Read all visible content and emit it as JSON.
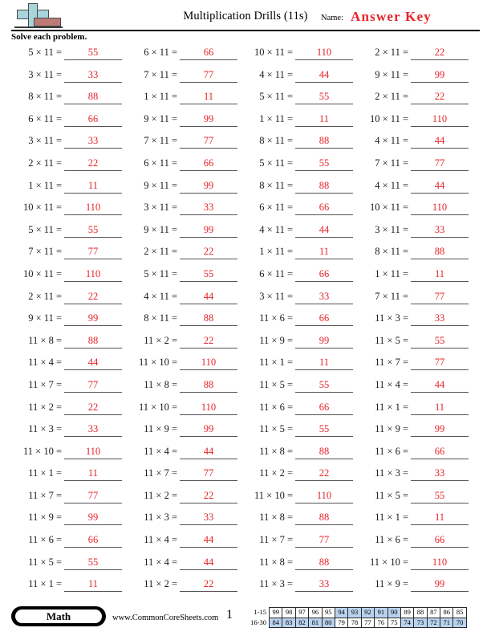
{
  "header": {
    "title": "Multiplication Drills (11s)",
    "name_label": "Name:",
    "answer_key": "Answer Key",
    "instructions": "Solve each problem.",
    "logo_name": "math-plus-logo",
    "answer_color": "#e8232a"
  },
  "footer": {
    "subject_badge": "Math",
    "site_url": "www.CommonCoreSheets.com",
    "page_number": "1",
    "score_rows": [
      {
        "label": "1-15",
        "cells": [
          {
            "value": "99",
            "highlighted": false
          },
          {
            "value": "98",
            "highlighted": false
          },
          {
            "value": "97",
            "highlighted": false
          },
          {
            "value": "96",
            "highlighted": false
          },
          {
            "value": "95",
            "highlighted": false
          },
          {
            "value": "94",
            "highlighted": true
          },
          {
            "value": "93",
            "highlighted": true
          },
          {
            "value": "92",
            "highlighted": true
          },
          {
            "value": "91",
            "highlighted": true
          },
          {
            "value": "90",
            "highlighted": true
          },
          {
            "value": "89",
            "highlighted": false
          },
          {
            "value": "88",
            "highlighted": false
          },
          {
            "value": "87",
            "highlighted": false
          },
          {
            "value": "86",
            "highlighted": false
          },
          {
            "value": "85",
            "highlighted": false
          }
        ]
      },
      {
        "label": "16-30",
        "cells": [
          {
            "value": "84",
            "highlighted": true
          },
          {
            "value": "83",
            "highlighted": true
          },
          {
            "value": "82",
            "highlighted": true
          },
          {
            "value": "81",
            "highlighted": true
          },
          {
            "value": "80",
            "highlighted": true
          },
          {
            "value": "79",
            "highlighted": false
          },
          {
            "value": "78",
            "highlighted": false
          },
          {
            "value": "77",
            "highlighted": false
          },
          {
            "value": "76",
            "highlighted": false
          },
          {
            "value": "75",
            "highlighted": false
          },
          {
            "value": "74",
            "highlighted": true
          },
          {
            "value": "73",
            "highlighted": true
          },
          {
            "value": "72",
            "highlighted": true
          },
          {
            "value": "71",
            "highlighted": true
          },
          {
            "value": "70",
            "highlighted": true
          }
        ]
      }
    ],
    "highlight_color": "#b9d2ee"
  },
  "columns": [
    {
      "problems": [
        {
          "question": "5 × 11 =",
          "answer": "55"
        },
        {
          "question": "3 × 11 =",
          "answer": "33"
        },
        {
          "question": "8 × 11 =",
          "answer": "88"
        },
        {
          "question": "6 × 11 =",
          "answer": "66"
        },
        {
          "question": "3 × 11 =",
          "answer": "33"
        },
        {
          "question": "2 × 11 =",
          "answer": "22"
        },
        {
          "question": "1 × 11 =",
          "answer": "11"
        },
        {
          "question": "10 × 11 =",
          "answer": "110"
        },
        {
          "question": "5 × 11 =",
          "answer": "55"
        },
        {
          "question": "7 × 11 =",
          "answer": "77"
        },
        {
          "question": "10 × 11 =",
          "answer": "110"
        },
        {
          "question": "2 × 11 =",
          "answer": "22"
        },
        {
          "question": "9 × 11 =",
          "answer": "99"
        },
        {
          "question": "11 × 8 =",
          "answer": "88"
        },
        {
          "question": "11 × 4 =",
          "answer": "44"
        },
        {
          "question": "11 × 7 =",
          "answer": "77"
        },
        {
          "question": "11 × 2 =",
          "answer": "22"
        },
        {
          "question": "11 × 3 =",
          "answer": "33"
        },
        {
          "question": "11 × 10 =",
          "answer": "110"
        },
        {
          "question": "11 × 1 =",
          "answer": "11"
        },
        {
          "question": "11 × 7 =",
          "answer": "77"
        },
        {
          "question": "11 × 9 =",
          "answer": "99"
        },
        {
          "question": "11 × 6 =",
          "answer": "66"
        },
        {
          "question": "11 × 5 =",
          "answer": "55"
        },
        {
          "question": "11 × 1 =",
          "answer": "11"
        }
      ]
    },
    {
      "problems": [
        {
          "question": "6 × 11 =",
          "answer": "66"
        },
        {
          "question": "7 × 11 =",
          "answer": "77"
        },
        {
          "question": "1 × 11 =",
          "answer": "11"
        },
        {
          "question": "9 × 11 =",
          "answer": "99"
        },
        {
          "question": "7 × 11 =",
          "answer": "77"
        },
        {
          "question": "6 × 11 =",
          "answer": "66"
        },
        {
          "question": "9 × 11 =",
          "answer": "99"
        },
        {
          "question": "3 × 11 =",
          "answer": "33"
        },
        {
          "question": "9 × 11 =",
          "answer": "99"
        },
        {
          "question": "2 × 11 =",
          "answer": "22"
        },
        {
          "question": "5 × 11 =",
          "answer": "55"
        },
        {
          "question": "4 × 11 =",
          "answer": "44"
        },
        {
          "question": "8 × 11 =",
          "answer": "88"
        },
        {
          "question": "11 × 2 =",
          "answer": "22"
        },
        {
          "question": "11 × 10 =",
          "answer": "110"
        },
        {
          "question": "11 × 8 =",
          "answer": "88"
        },
        {
          "question": "11 × 10 =",
          "answer": "110"
        },
        {
          "question": "11 × 9 =",
          "answer": "99"
        },
        {
          "question": "11 × 4 =",
          "answer": "44"
        },
        {
          "question": "11 × 7 =",
          "answer": "77"
        },
        {
          "question": "11 × 2 =",
          "answer": "22"
        },
        {
          "question": "11 × 3 =",
          "answer": "33"
        },
        {
          "question": "11 × 4 =",
          "answer": "44"
        },
        {
          "question": "11 × 4 =",
          "answer": "44"
        },
        {
          "question": "11 × 2 =",
          "answer": "22"
        }
      ]
    },
    {
      "problems": [
        {
          "question": "10 × 11 =",
          "answer": "110"
        },
        {
          "question": "4 × 11 =",
          "answer": "44"
        },
        {
          "question": "5 × 11 =",
          "answer": "55"
        },
        {
          "question": "1 × 11 =",
          "answer": "11"
        },
        {
          "question": "8 × 11 =",
          "answer": "88"
        },
        {
          "question": "5 × 11 =",
          "answer": "55"
        },
        {
          "question": "8 × 11 =",
          "answer": "88"
        },
        {
          "question": "6 × 11 =",
          "answer": "66"
        },
        {
          "question": "4 × 11 =",
          "answer": "44"
        },
        {
          "question": "1 × 11 =",
          "answer": "11"
        },
        {
          "question": "6 × 11 =",
          "answer": "66"
        },
        {
          "question": "3 × 11 =",
          "answer": "33"
        },
        {
          "question": "11 × 6 =",
          "answer": "66"
        },
        {
          "question": "11 × 9 =",
          "answer": "99"
        },
        {
          "question": "11 × 1 =",
          "answer": "11"
        },
        {
          "question": "11 × 5 =",
          "answer": "55"
        },
        {
          "question": "11 × 6 =",
          "answer": "66"
        },
        {
          "question": "11 × 5 =",
          "answer": "55"
        },
        {
          "question": "11 × 8 =",
          "answer": "88"
        },
        {
          "question": "11 × 2 =",
          "answer": "22"
        },
        {
          "question": "11 × 10 =",
          "answer": "110"
        },
        {
          "question": "11 × 8 =",
          "answer": "88"
        },
        {
          "question": "11 × 7 =",
          "answer": "77"
        },
        {
          "question": "11 × 8 =",
          "answer": "88"
        },
        {
          "question": "11 × 3 =",
          "answer": "33"
        }
      ]
    },
    {
      "problems": [
        {
          "question": "2 × 11 =",
          "answer": "22"
        },
        {
          "question": "9 × 11 =",
          "answer": "99"
        },
        {
          "question": "2 × 11 =",
          "answer": "22"
        },
        {
          "question": "10 × 11 =",
          "answer": "110"
        },
        {
          "question": "4 × 11 =",
          "answer": "44"
        },
        {
          "question": "7 × 11 =",
          "answer": "77"
        },
        {
          "question": "4 × 11 =",
          "answer": "44"
        },
        {
          "question": "10 × 11 =",
          "answer": "110"
        },
        {
          "question": "3 × 11 =",
          "answer": "33"
        },
        {
          "question": "8 × 11 =",
          "answer": "88"
        },
        {
          "question": "1 × 11 =",
          "answer": "11"
        },
        {
          "question": "7 × 11 =",
          "answer": "77"
        },
        {
          "question": "11 × 3 =",
          "answer": "33"
        },
        {
          "question": "11 × 5 =",
          "answer": "55"
        },
        {
          "question": "11 × 7 =",
          "answer": "77"
        },
        {
          "question": "11 × 4 =",
          "answer": "44"
        },
        {
          "question": "11 × 1 =",
          "answer": "11"
        },
        {
          "question": "11 × 9 =",
          "answer": "99"
        },
        {
          "question": "11 × 6 =",
          "answer": "66"
        },
        {
          "question": "11 × 3 =",
          "answer": "33"
        },
        {
          "question": "11 × 5 =",
          "answer": "55"
        },
        {
          "question": "11 × 1 =",
          "answer": "11"
        },
        {
          "question": "11 × 6 =",
          "answer": "66"
        },
        {
          "question": "11 × 10 =",
          "answer": "110"
        },
        {
          "question": "11 × 9 =",
          "answer": "99"
        }
      ]
    }
  ]
}
